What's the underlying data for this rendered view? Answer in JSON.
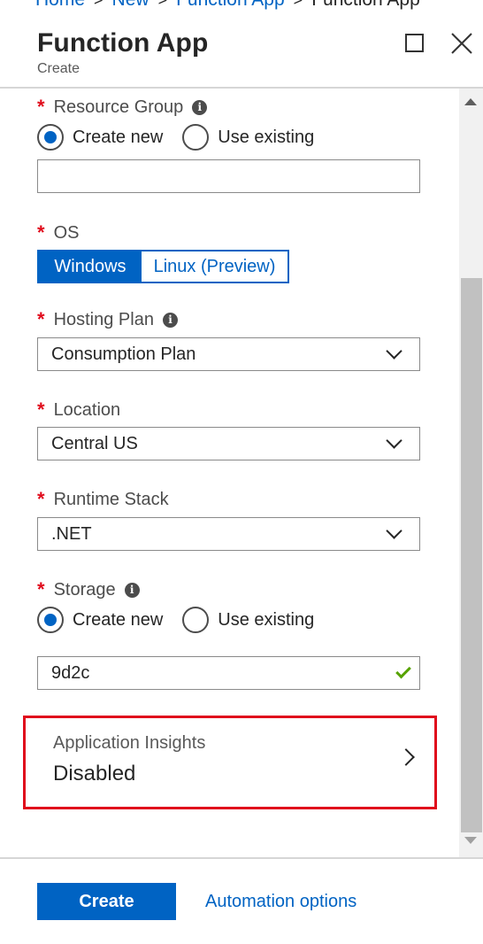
{
  "breadcrumb": {
    "items": [
      "Home",
      "New",
      "Function App",
      "Function App"
    ],
    "sep": ">"
  },
  "header": {
    "title": "Function App",
    "subtitle": "Create"
  },
  "form": {
    "resource_group": {
      "label": "Resource Group",
      "options": [
        "Create new",
        "Use existing"
      ],
      "selected": "Create new",
      "value": ""
    },
    "os": {
      "label": "OS",
      "options": [
        "Windows",
        "Linux (Preview)"
      ],
      "selected": "Windows"
    },
    "hosting_plan": {
      "label": "Hosting Plan",
      "value": "Consumption Plan"
    },
    "location": {
      "label": "Location",
      "value": "Central US"
    },
    "runtime_stack": {
      "label": "Runtime Stack",
      "value": ".NET"
    },
    "storage": {
      "label": "Storage",
      "options": [
        "Create new",
        "Use existing"
      ],
      "selected": "Create new",
      "value": "9d2c"
    },
    "app_insights": {
      "label": "Application Insights",
      "value": "Disabled"
    }
  },
  "footer": {
    "create_label": "Create",
    "automation_label": "Automation options"
  },
  "icons": {
    "required": "*",
    "info": "i"
  },
  "colors": {
    "accent": "#0063c3",
    "required": "#e00b1c",
    "highlight": "#e00b1c",
    "valid": "#57a300"
  }
}
